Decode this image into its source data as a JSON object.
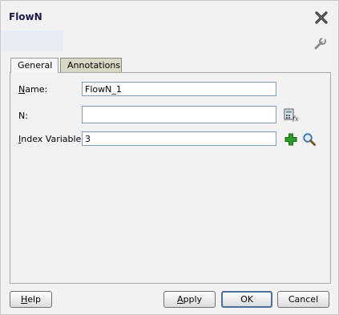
{
  "window": {
    "title": "FlowN"
  },
  "icons": {
    "close": "close-icon",
    "tool": "wrench-icon",
    "expression_builder": "expression-builder-icon",
    "add": "add-icon",
    "search": "search-icon"
  },
  "tabs": [
    {
      "label": "General",
      "selected": true
    },
    {
      "label": "Annotations",
      "selected": false
    }
  ],
  "form": {
    "name": {
      "label_mnemonic": "N",
      "label_rest": "ame:",
      "value": "FlowN_1"
    },
    "n": {
      "label": "N:",
      "value": ""
    },
    "index_variable": {
      "label_mnemonic": "I",
      "label_rest": "ndex Variable:",
      "value": "3"
    }
  },
  "buttons": {
    "help_mnemonic": "H",
    "help_rest": "elp",
    "apply_mnemonic": "A",
    "apply_rest": "pply",
    "ok": "OK",
    "cancel": "Cancel"
  },
  "colors": {
    "title_text": "#1a1a4a",
    "add_green": "#2a9d2a",
    "ok_border": "#4d6f9c"
  }
}
